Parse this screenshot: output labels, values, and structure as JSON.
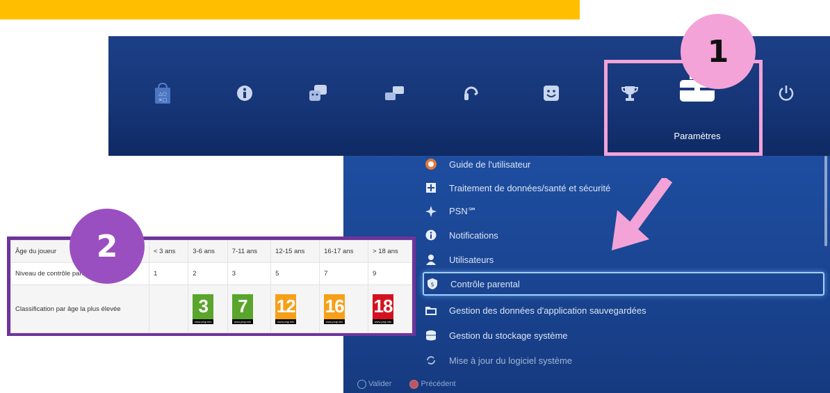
{
  "colors": {
    "yellow_bar": "#ffbf00",
    "pink_accent": "#f3a3d8",
    "purple_accent": "#6e349a",
    "ps4_blue": "#1a4592",
    "selection": "#9fd0ff"
  },
  "callouts": {
    "one": "1",
    "two": "2"
  },
  "function_bar": {
    "icons": [
      "playstation-store-icon",
      "info-icon",
      "friends-icon",
      "messages-icon",
      "party-icon",
      "profile-icon",
      "trophy-icon",
      "settings-toolbox-icon",
      "power-icon"
    ],
    "selected_label": "Paramètres"
  },
  "settings_list": {
    "items": [
      {
        "label": "Guide de l'utilisateur",
        "icon": "user-guide-icon"
      },
      {
        "label": "Traitement de données/santé et sécurité",
        "icon": "health-safety-icon"
      },
      {
        "label": "PSN℠",
        "icon": "psn-icon"
      },
      {
        "label": "Notifications",
        "icon": "info-icon"
      },
      {
        "label": "Utilisateurs",
        "icon": "user-icon"
      },
      {
        "label": "Contrôle parental",
        "icon": "parental-control-icon",
        "selected": true
      },
      {
        "label": "Gestion des données d'application sauvegardées",
        "icon": "folder-icon"
      },
      {
        "label": "Gestion du stockage système",
        "icon": "storage-icon"
      },
      {
        "label": "Mise à jour du logiciel système",
        "icon": "update-icon"
      }
    ],
    "footer": {
      "confirm": "Valider",
      "back": "Précédent"
    }
  },
  "age_table": {
    "headers": [
      "Âge du joueur",
      "< 3 ans",
      "3-6 ans",
      "7-11 ans",
      "12-15 ans",
      "16-17 ans",
      "> 18 ans"
    ],
    "row_level": [
      "Niveau de contrôle parental PS4",
      "1",
      "2",
      "3",
      "5",
      "7",
      "9"
    ],
    "row_rating_label": "Classification par âge la plus élevée",
    "pegi": [
      {
        "value": "3",
        "color": "#5aa52b"
      },
      {
        "value": "7",
        "color": "#5aa52b"
      },
      {
        "value": "12",
        "color": "#f6a01a"
      },
      {
        "value": "16",
        "color": "#f6a01a"
      },
      {
        "value": "18",
        "color": "#d4121f"
      }
    ],
    "pegi_footer": "www.pegi.info"
  }
}
